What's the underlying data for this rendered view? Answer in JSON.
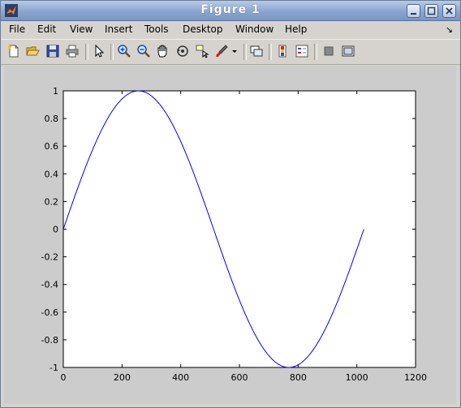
{
  "window": {
    "title": "Figure 1"
  },
  "menu": {
    "file": "File",
    "edit": "Edit",
    "view": "View",
    "insert": "Insert",
    "tools": "Tools",
    "desktop": "Desktop",
    "window": "Window",
    "help": "Help"
  },
  "toolbar_icons": [
    "new-figure-icon",
    "open-file-icon",
    "save-icon",
    "print-icon",
    "edit-plot-arrow-icon",
    "zoom-in-icon",
    "zoom-out-icon",
    "pan-hand-icon",
    "rotate-3d-icon",
    "data-cursor-icon",
    "brush-icon",
    "brush-dropdown-icon",
    "link-plot-icon",
    "insert-colorbar-icon",
    "insert-legend-icon",
    "hide-plot-tools-icon",
    "show-plot-tools-icon"
  ],
  "chart_data": {
    "type": "line",
    "function": "sine, one full period",
    "x_start": 0,
    "x_end": 1024,
    "y_start": 0,
    "y_peak": 1,
    "y_trough": -1,
    "xlim": [
      0,
      1200
    ],
    "ylim": [
      -1,
      1
    ],
    "xticks": [
      "0",
      "200",
      "400",
      "600",
      "800",
      "1000",
      "1200"
    ],
    "yticks": [
      "-1",
      "-0.8",
      "-0.6",
      "-0.4",
      "-0.2",
      "0",
      "0.2",
      "0.4",
      "0.6",
      "0.8",
      "1"
    ],
    "line_color": "#0000ff",
    "grid": false,
    "title": "",
    "xlabel": "",
    "ylabel": ""
  }
}
